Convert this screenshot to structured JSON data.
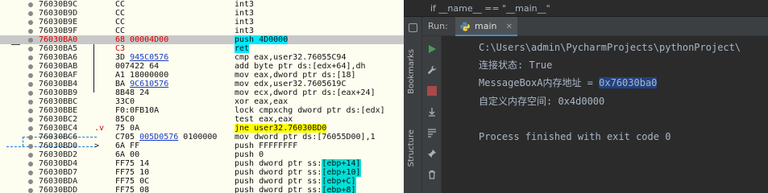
{
  "debugger": {
    "rows": [
      {
        "addr": "76030B9C",
        "mark": "",
        "bytes": "CC",
        "bytes_style": "",
        "instr": "int3",
        "instr_style": "",
        "addr_red": false
      },
      {
        "addr": "76030B9D",
        "mark": "",
        "bytes": "CC",
        "bytes_style": "",
        "instr": "int3",
        "instr_style": "",
        "addr_red": false
      },
      {
        "addr": "76030B9E",
        "mark": "",
        "bytes": "CC",
        "bytes_style": "",
        "instr": "int3",
        "instr_style": "",
        "addr_red": false
      },
      {
        "addr": "76030B9F",
        "mark": "",
        "bytes": "CC",
        "bytes_style": "",
        "instr": "int3",
        "instr_style": "",
        "addr_red": false
      },
      {
        "addr": "76030BA0",
        "mark": "",
        "bytes": "68 00004D00",
        "bytes_style": "red",
        "instr": "push 4D0000",
        "instr_style": "cyan",
        "addr_red": true
      },
      {
        "addr": "76030BA5",
        "mark": "",
        "bytes": "C3",
        "bytes_style": "red",
        "instr": "ret",
        "instr_style": "cyan",
        "addr_red": false
      },
      {
        "addr": "76030BA6",
        "mark": "",
        "bytes": "3D 945C0576",
        "bytes_style": "",
        "instr": "cmp eax,user32.76055C94",
        "instr_style": "",
        "addr_red": false
      },
      {
        "addr": "76030BAB",
        "mark": "",
        "bytes": "007422 64",
        "bytes_style": "",
        "instr": "add byte ptr ds:[edx+64],dh",
        "instr_style": "",
        "addr_red": false
      },
      {
        "addr": "76030BAF",
        "mark": "",
        "bytes": "A1 18000000",
        "bytes_style": "",
        "instr": "mov eax,dword ptr ds:[18]",
        "instr_style": "",
        "addr_red": false
      },
      {
        "addr": "76030BB4",
        "mark": "",
        "bytes": "BA 9C610576",
        "bytes_style": "",
        "instr": "mov edx,user32.7605619C",
        "instr_style": "",
        "addr_red": false
      },
      {
        "addr": "76030BB9",
        "mark": "",
        "bytes": "8B48 24",
        "bytes_style": "",
        "instr": "mov ecx,dword ptr ds:[eax+24]",
        "instr_style": "",
        "addr_red": false
      },
      {
        "addr": "76030BBC",
        "mark": "",
        "bytes": "33C0",
        "bytes_style": "",
        "instr": "xor eax,eax",
        "instr_style": "",
        "addr_red": false
      },
      {
        "addr": "76030BBE",
        "mark": "",
        "bytes": "F0:0FB10A",
        "bytes_style": "",
        "instr": "lock cmpxchg dword ptr ds:[edx]",
        "instr_style": "",
        "addr_red": false
      },
      {
        "addr": "76030BC2",
        "mark": "",
        "bytes": "85C0",
        "bytes_style": "",
        "instr": "test eax,eax",
        "instr_style": "",
        "addr_red": false
      },
      {
        "addr": "76030BC4",
        "mark": ".v",
        "bytes": "75 0A",
        "bytes_style": "",
        "instr": "jne user32.76030BD0",
        "instr_style": "yellow",
        "addr_red": false
      },
      {
        "addr": "76030BC6",
        "mark": "",
        "bytes": "C705 005D0576 0100000",
        "bytes_style": "",
        "instr": "mov dword ptr ds:[76055D00],1",
        "instr_style": "",
        "addr_red": false
      },
      {
        "addr": "76030BD0",
        "mark": ">",
        "bytes": "6A FF",
        "bytes_style": "",
        "instr": "push FFFFFFFF",
        "instr_style": "",
        "addr_red": false
      },
      {
        "addr": "76030BD2",
        "mark": "",
        "bytes": "6A 00",
        "bytes_style": "",
        "instr": "push 0",
        "instr_style": "",
        "addr_red": false
      },
      {
        "addr": "76030BD4",
        "mark": "",
        "bytes": "FF75 14",
        "bytes_style": "",
        "instr": "push dword ptr ss:[ebp+14]",
        "instr_style": "",
        "addr_red": false
      },
      {
        "addr": "76030BD7",
        "mark": "",
        "bytes": "FF75 10",
        "bytes_style": "",
        "instr": "push dword ptr ss:[ebp+10]",
        "instr_style": "",
        "addr_red": false
      },
      {
        "addr": "76030BDA",
        "mark": "",
        "bytes": "FF75 0C",
        "bytes_style": "",
        "instr": "push dword ptr ss:[ebp+C]",
        "instr_style": "",
        "addr_red": false
      },
      {
        "addr": "76030BDD",
        "mark": "",
        "bytes": "FF75 08",
        "bytes_style": "",
        "instr": "push dword ptr ss:[ebp+8]",
        "instr_style": "",
        "addr_red": false
      }
    ]
  },
  "ide": {
    "code_crumb": "if __name__ == \"__main__\"",
    "side_tabs": {
      "bookmarks": "Bookmarks",
      "structure": "Structure"
    },
    "run_label": "Run:",
    "run_tab": "main",
    "console": {
      "line1": "C:\\Users\\admin\\PycharmProjects\\pythonProject\\",
      "line2": "连接状态: True",
      "line3_prefix": "MessageBoxA内存地址 = ",
      "line3_selected": "0x76030ba0",
      "line4": "自定义内存空间: 0x4d0000",
      "line5": "",
      "line6": "Process finished with exit code 0"
    }
  },
  "colors": {
    "accent_blue": "#4a88c7",
    "selection": "#214283",
    "run_green": "#499c54",
    "active_row": "#c8c8c8"
  }
}
